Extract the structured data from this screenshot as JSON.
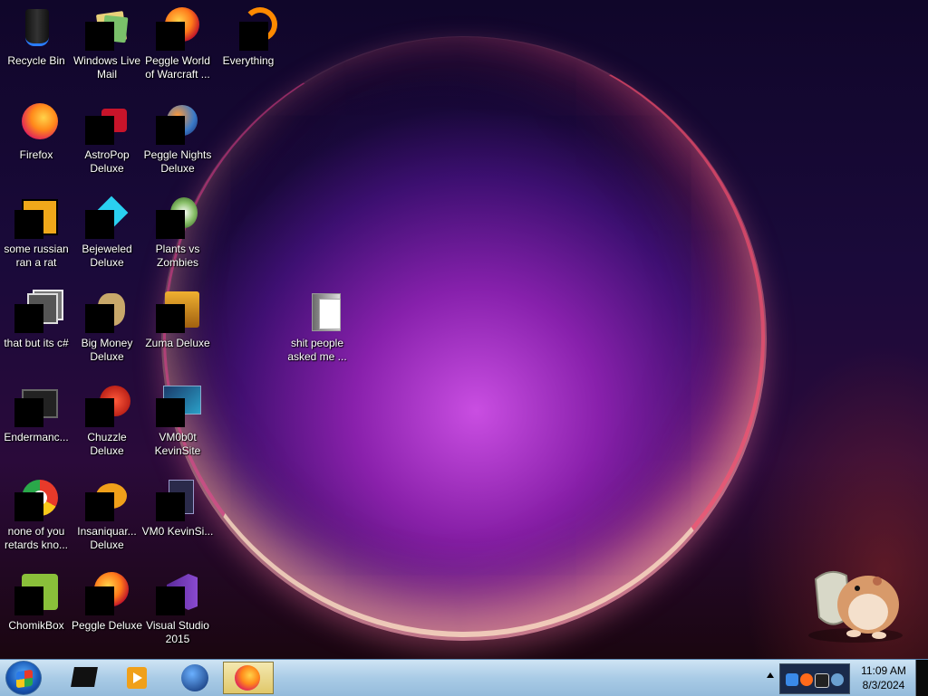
{
  "desktop": {
    "icons": [
      {
        "label": "Recycle Bin",
        "icon": "recycle-bin-icon"
      },
      {
        "label": "Windows Live Mail",
        "icon": "windows-live-mail-icon"
      },
      {
        "label": "Peggle World of Warcraft ...",
        "icon": "peggle-wow-icon"
      },
      {
        "label": "Everything",
        "icon": "everything-search-icon"
      },
      {
        "label": "Firefox",
        "icon": "firefox-icon"
      },
      {
        "label": "AstroPop Deluxe",
        "icon": "astropop-icon"
      },
      {
        "label": "Peggle Nights Deluxe",
        "icon": "peggle-nights-icon"
      },
      {
        "label": "some russian ran a rat",
        "icon": "ie-shortcut-icon"
      },
      {
        "label": "Bejeweled Deluxe",
        "icon": "bejeweled-icon"
      },
      {
        "label": "Plants vs Zombies",
        "icon": "plants-vs-zombies-icon"
      },
      {
        "label": "that but its c#",
        "icon": "windows-stack-icon"
      },
      {
        "label": "Big Money Deluxe",
        "icon": "big-money-icon"
      },
      {
        "label": "Zuma Deluxe",
        "icon": "zuma-icon"
      },
      {
        "label": "shit people asked me ...",
        "icon": "folder-icon"
      },
      {
        "label": "Endermanc...",
        "icon": "terminal-icon"
      },
      {
        "label": "Chuzzle Deluxe",
        "icon": "chuzzle-icon"
      },
      {
        "label": "VM0b0t KevinSite",
        "icon": "screenshot-icon"
      },
      {
        "label": "none of you retards kno...",
        "icon": "chrome-icon"
      },
      {
        "label": "Insaniquar... Deluxe",
        "icon": "insaniquarium-icon"
      },
      {
        "label": "VM0 KevinSi...",
        "icon": "document-icon"
      },
      {
        "label": "ChomikBox",
        "icon": "chomikbox-icon"
      },
      {
        "label": "Peggle Deluxe",
        "icon": "peggle-deluxe-icon"
      },
      {
        "label": "Visual Studio 2015",
        "icon": "visual-studio-icon"
      }
    ]
  },
  "taskbar": {
    "start": {
      "icon": "windows-start-icon"
    },
    "pinned": [
      {
        "icon": "explorer-icon"
      },
      {
        "icon": "media-player-icon"
      },
      {
        "icon": "globe-icon"
      },
      {
        "icon": "firefox-icon",
        "active": true
      }
    ],
    "tray": {
      "icons": [
        "tray-chevron-icon",
        "network-icon",
        "firefox-tray-icon",
        "monitor-icon",
        "audio-icon"
      ]
    },
    "clock": {
      "time": "11:09 AM",
      "date": "8/3/2024"
    }
  },
  "colors": {
    "taskbar": "#a9cbe6",
    "accent": "#2a7cff"
  }
}
